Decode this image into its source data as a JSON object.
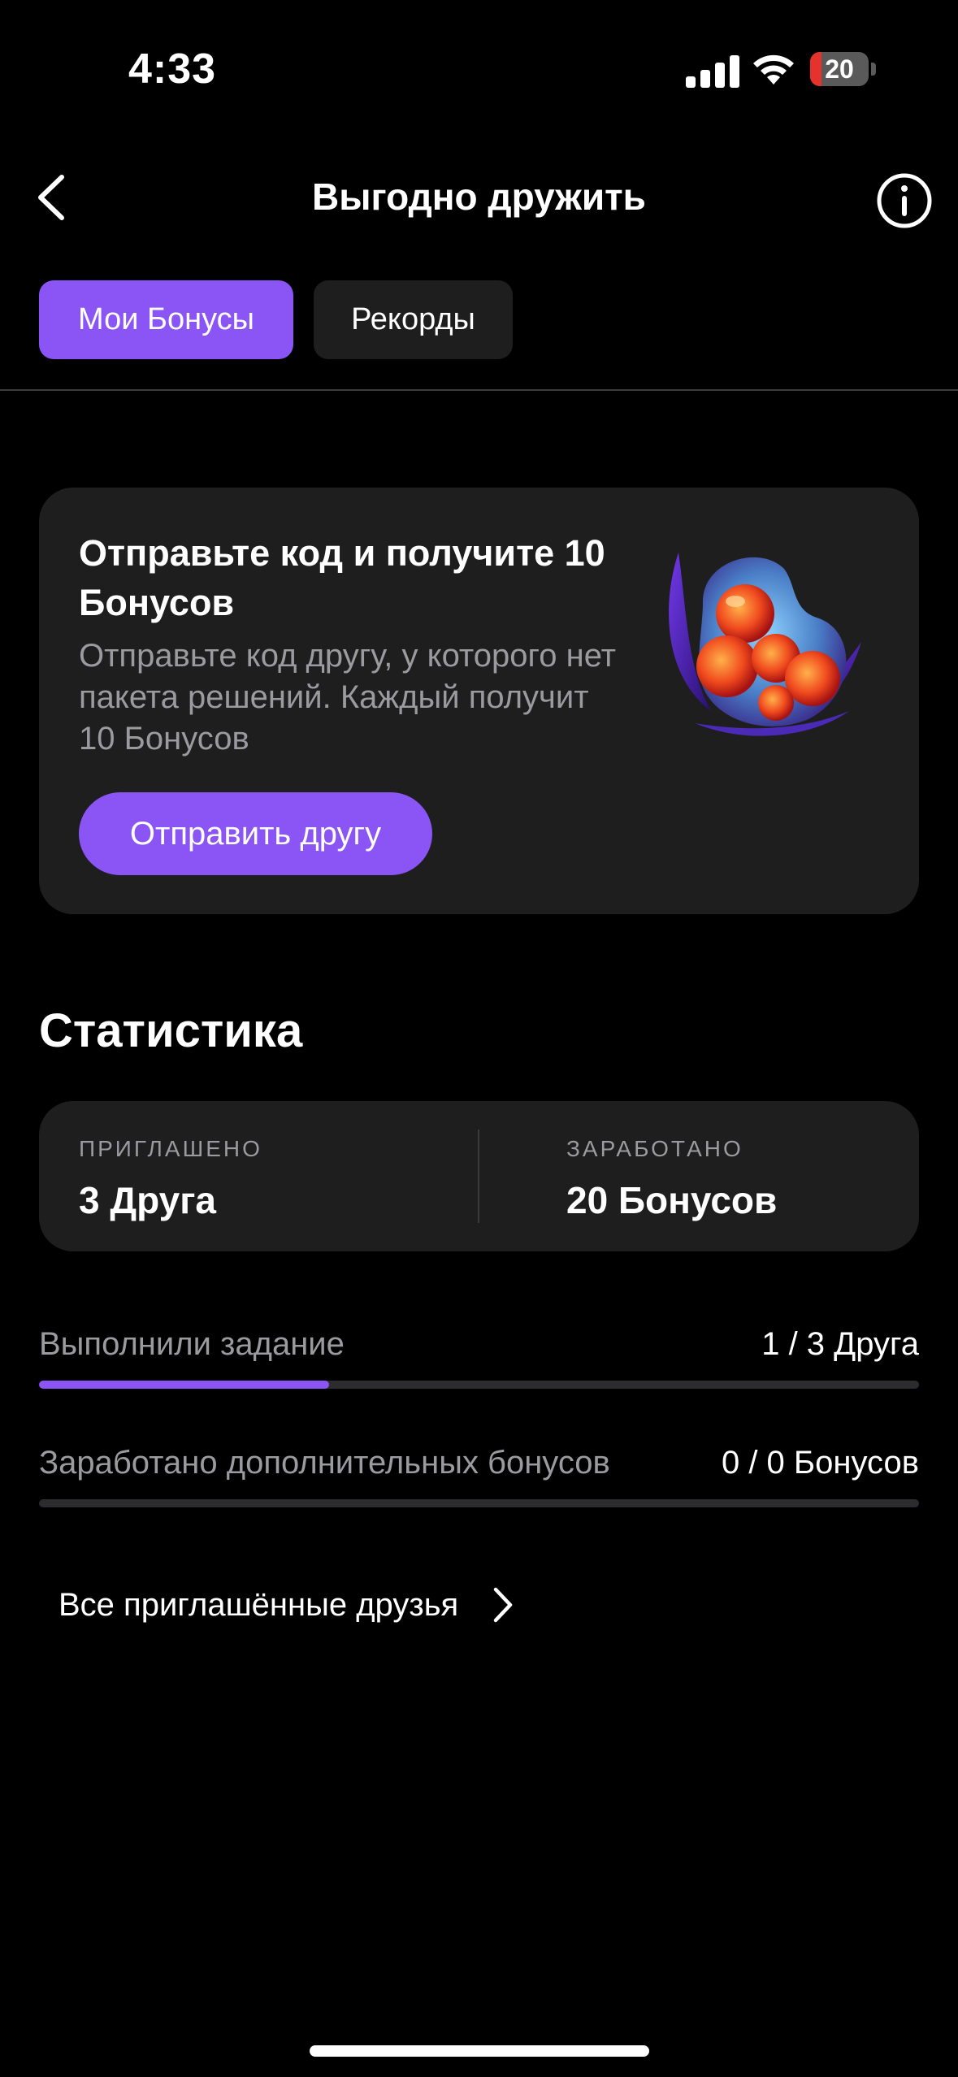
{
  "status_bar": {
    "time": "4:33",
    "battery_level": "20",
    "battery_fraction": 0.2,
    "icons": [
      "cellular-signal-icon",
      "wifi-icon",
      "battery-icon"
    ]
  },
  "nav": {
    "title": "Выгодно дружить",
    "back_icon": "chevron-left-icon",
    "info_icon": "info-circle-icon"
  },
  "tabs": [
    {
      "label": "Мои Бонусы",
      "selected": true
    },
    {
      "label": "Рекорды",
      "selected": false
    }
  ],
  "promo": {
    "title": "Отправьте код и получите 10 Бонусов",
    "description": "Отправьте код другу, у которого нет пакета решений. Каждый получит 10 Бонусов",
    "button_label": "Отправить другу",
    "image": "gem-icon"
  },
  "stats": {
    "heading": "Статистика",
    "invited_label": "ПРИГЛАШЕНО",
    "invited_value": "3 Друга",
    "earned_label": "ЗАРАБОТАНО",
    "earned_value": "20 Бонусов"
  },
  "progress": [
    {
      "label": "Выполнили задание",
      "value": "1 / 3 Друга",
      "fraction": 0.33
    },
    {
      "label": "Заработано дополнительных бонусов",
      "value": "0 / 0 Бонусов",
      "fraction": 0
    }
  ],
  "friends_link": {
    "label": "Все приглашённые друзья",
    "icon": "chevron-right-icon"
  },
  "colors": {
    "accent": "#8b55f6",
    "card": "#1e1e1f",
    "background": "#000000",
    "muted_text": "#9a9a9f",
    "battery_low": "#e5322c"
  }
}
